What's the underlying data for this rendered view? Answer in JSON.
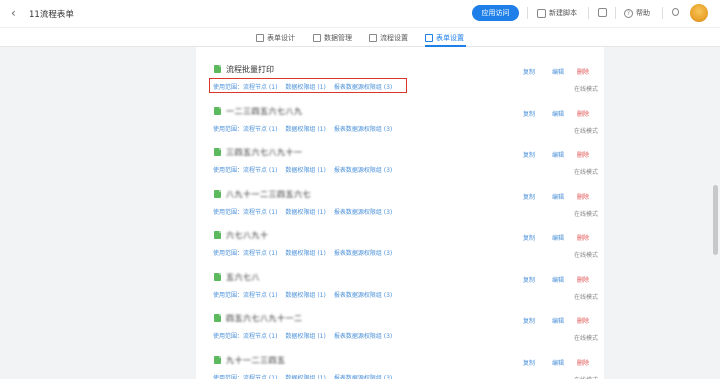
{
  "header": {
    "back_icon": "chevron-left-icon",
    "title": "11流程表单",
    "publish_label": "应用访问",
    "script_label": "新建脚本",
    "help_label": "帮助"
  },
  "tabs": [
    {
      "label": "表单设计",
      "active": false
    },
    {
      "label": "数据管理",
      "active": false
    },
    {
      "label": "流程设置",
      "active": false
    },
    {
      "label": "表单设置",
      "active": true
    }
  ],
  "row_actions": {
    "copy": "复制",
    "edit": "编辑",
    "delete": "删除"
  },
  "mode_label": "在线模式",
  "link_labels": [
    "使用范围：流程节点 (1)",
    "数据权限组 (1)",
    "报表数据源权限组 (3)"
  ],
  "templates": [
    {
      "title": "流程批量打印",
      "blurred": false
    },
    {
      "title": "一二三四五六七八九",
      "blurred": true
    },
    {
      "title": "三四五六七八九十一",
      "blurred": true
    },
    {
      "title": "八九十一二三四五六七",
      "blurred": true
    },
    {
      "title": "六七八九十",
      "blurred": true
    },
    {
      "title": "五六七八",
      "blurred": true
    },
    {
      "title": "四五六七八九十一二",
      "blurred": true
    },
    {
      "title": "九十一二三四五",
      "blurred": true
    }
  ],
  "colors": {
    "accent": "#1e7fe8",
    "link": "#4a90d9",
    "danger": "#e05050",
    "highlight_border": "#d9362c",
    "doc_icon": "#5db95d"
  }
}
